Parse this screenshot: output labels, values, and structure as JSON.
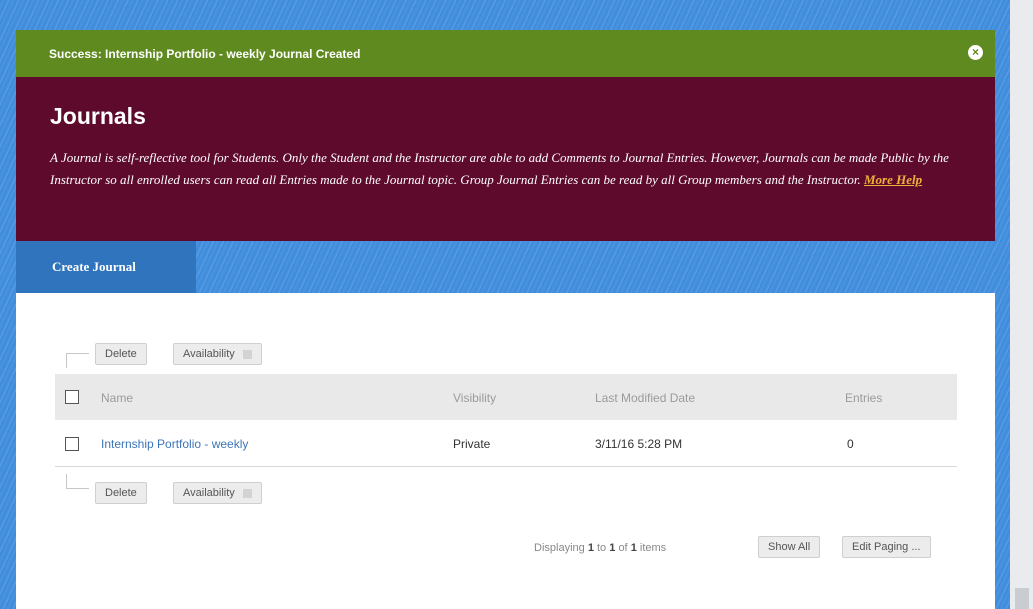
{
  "success": {
    "message": "Success: Internship Portfolio - weekly Journal Created"
  },
  "header": {
    "title": "Journals",
    "description": "A Journal is self-reflective tool for Students. Only the Student and the Instructor are able to add Comments to Journal Entries. However, Journals can be made Public by the Instructor so all enrolled users can read all Entries made to the Journal topic. Group Journal Entries can be read by all Group members and the Instructor.",
    "more_help": "More Help"
  },
  "action_bar": {
    "create_journal": "Create Journal"
  },
  "toolbar": {
    "delete": "Delete",
    "availability": "Availability"
  },
  "table": {
    "columns": [
      "Name",
      "Visibility",
      "Last Modified Date",
      "Entries"
    ],
    "rows": [
      {
        "name": "Internship Portfolio - weekly",
        "visibility": "Private",
        "modified": "3/11/16 5:28 PM",
        "entries": "0"
      }
    ]
  },
  "paging": {
    "prefix": "Displaying",
    "from": "1",
    "to_word": "to",
    "to": "1",
    "of_word": "of",
    "total": "1",
    "items_word": "items",
    "show_all": "Show All",
    "edit_paging": "Edit Paging ..."
  },
  "colors": {
    "success": "#5f8a1f",
    "header": "#5e0a2d",
    "action_bar": "#3b86d6",
    "link": "#3b75b8",
    "more_help": "#f0b13a"
  }
}
